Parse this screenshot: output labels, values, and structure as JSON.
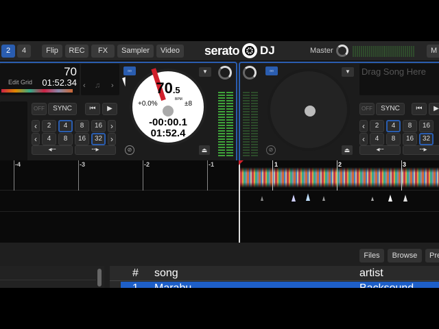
{
  "topbar": {
    "layout_buttons": [
      "2",
      "4"
    ],
    "panel_buttons": [
      "Flip",
      "REC",
      "FX",
      "Sampler",
      "Video"
    ],
    "logo": {
      "word": "serato",
      "suffix": "DJ"
    },
    "master_label": "Master",
    "right_cut_label": "M"
  },
  "deck_left": {
    "bpm": "70",
    "edit_grid": "Edit Grid",
    "time_remaining": "01:52.34",
    "sync": "SYNC",
    "off": "OFF",
    "loop_row1": [
      "2",
      "4",
      "8",
      "16"
    ],
    "loop_row2": [
      "4",
      "8",
      "16",
      "32"
    ],
    "loop_row1_selected": "4",
    "loop_row2_selected": "32",
    "platter": {
      "bpm_main": "70",
      "bpm_dec": ".5",
      "bpm_unit": "BPM",
      "pitch": "+0.0%",
      "range": "±8",
      "elapsed": "-00:00.1",
      "total": "01:52.4"
    }
  },
  "deck_right": {
    "placeholder": "Drag Song Here",
    "sync": "SYNC",
    "off": "OFF",
    "loop_row1": [
      "2",
      "4",
      "8",
      "16"
    ],
    "loop_row2": [
      "4",
      "8",
      "16",
      "32"
    ],
    "loop_row1_selected": "4",
    "loop_row2_selected": "32"
  },
  "waveform": {
    "beat_markers": [
      "-4",
      "-3",
      "-2",
      "-1",
      "1",
      "2",
      "3"
    ]
  },
  "library": {
    "buttons": [
      "Files",
      "Browse",
      "Pre"
    ],
    "columns": {
      "num": "#",
      "song": "song",
      "artist": "artist"
    },
    "row": {
      "num": "1",
      "song": "Marabu",
      "artist": "Backsound"
    }
  },
  "colors": {
    "accent": "#2a5db0",
    "needle": "#d01f2b"
  }
}
